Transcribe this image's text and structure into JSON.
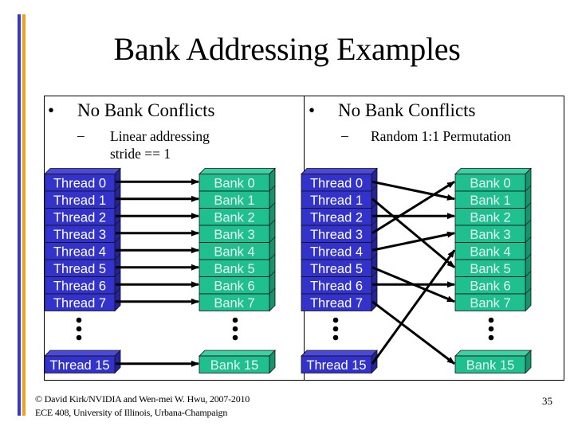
{
  "slide": {
    "title": "Bank Addressing Examples",
    "page_number": "35",
    "footer_lines": [
      "© David Kirk/NVIDIA and Wen-mei W. Hwu, 2007-2010",
      "ECE 408, University of Illinois, Urbana-Champaign"
    ],
    "accent_bars": {
      "blue": "#3a3ab8",
      "orange": "#f0a020"
    }
  },
  "colors": {
    "thread_front": "#3333cc",
    "thread_top": "#4a4ad6",
    "thread_side": "#24249a",
    "thread_text": "#ffffff",
    "bank_front": "#1fbf8f",
    "bank_top": "#3fd0a2",
    "bank_side": "#15956e",
    "bank_text": "#e6f7f1",
    "arrow": "#000000"
  },
  "panels": [
    {
      "bullet": "•",
      "heading": "No Bank Conflicts",
      "dash": "–",
      "sub_lines": [
        "Linear addressing",
        "stride == 1"
      ],
      "threads": [
        "Thread 0",
        "Thread 1",
        "Thread 2",
        "Thread 3",
        "Thread 4",
        "Thread 5",
        "Thread 6",
        "Thread 7"
      ],
      "thread_last": "Thread 15",
      "banks": [
        "Bank 0",
        "Bank 1",
        "Bank 2",
        "Bank 3",
        "Bank 4",
        "Bank 5",
        "Bank 6",
        "Bank 7"
      ],
      "bank_last": "Bank 15",
      "mapping": [
        {
          "thread": 0,
          "bank": 0
        },
        {
          "thread": 1,
          "bank": 1
        },
        {
          "thread": 2,
          "bank": 2
        },
        {
          "thread": 3,
          "bank": 3
        },
        {
          "thread": 4,
          "bank": 4
        },
        {
          "thread": 5,
          "bank": 5
        },
        {
          "thread": 6,
          "bank": 6
        },
        {
          "thread": 7,
          "bank": 7
        },
        {
          "thread": 15,
          "bank": 15
        }
      ]
    },
    {
      "bullet": "•",
      "heading": "No Bank Conflicts",
      "dash": "–",
      "sub_lines": [
        "Random 1:1 Permutation"
      ],
      "threads": [
        "Thread 0",
        "Thread 1",
        "Thread 2",
        "Thread 3",
        "Thread 4",
        "Thread 5",
        "Thread 6",
        "Thread 7"
      ],
      "thread_last": "Thread 15",
      "banks": [
        "Bank 0",
        "Bank 1",
        "Bank 2",
        "Bank 3",
        "Bank 4",
        "Bank 5",
        "Bank 6",
        "Bank 7"
      ],
      "bank_last": "Bank 15",
      "mapping": [
        {
          "thread": 0,
          "bank": 1
        },
        {
          "thread": 1,
          "bank": 5
        },
        {
          "thread": 2,
          "bank": 2
        },
        {
          "thread": 3,
          "bank": 0
        },
        {
          "thread": 4,
          "bank": 3
        },
        {
          "thread": 5,
          "bank": 7
        },
        {
          "thread": 6,
          "bank": 6
        },
        {
          "thread": 7,
          "bank": 15
        },
        {
          "thread": 15,
          "bank": 4
        }
      ]
    }
  ]
}
